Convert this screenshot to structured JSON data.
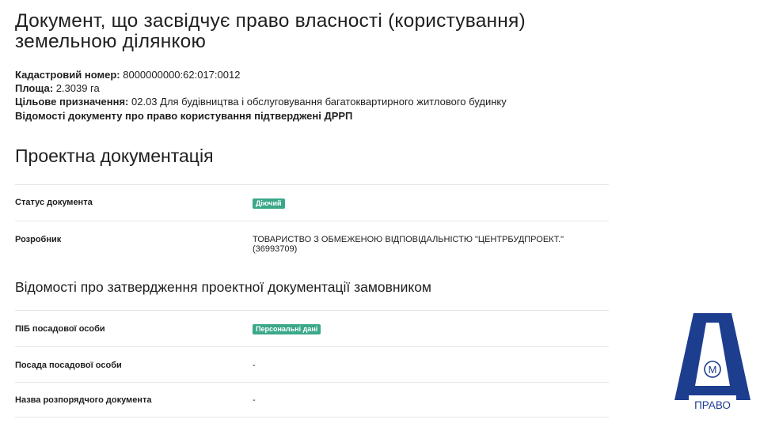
{
  "document": {
    "title": "Документ, що засвідчує право власності (користування) земельною ділянкою",
    "cadastral_label": "Кадастровий номер:",
    "cadastral_value": "8000000000:62:017:0012",
    "area_label": "Площа:",
    "area_value": "2.3039 га",
    "purpose_label": "Цільове призначення:",
    "purpose_value": "02.03 Для будівництва і обслуговування багатоквартирного житлового будинку",
    "drrp_note": "Відомості документу про право користування підтверджені ДРРП"
  },
  "project_docs": {
    "title": "Проектна документація",
    "rows": [
      {
        "label": "Статус документа",
        "badge": "Діючий"
      },
      {
        "label": "Розробник",
        "value": "ТОВАРИСТВО З ОБМЕЖЕНОЮ ВІДПОВІДАЛЬНІСТЮ \"ЦЕНТРБУДПРОЕКТ.\" (36993709)"
      }
    ]
  },
  "approval": {
    "title": "Відомості про затвердження проектної документації замовником",
    "rows": [
      {
        "label": "ПІБ посадової особи",
        "badge": "Персональні дані"
      },
      {
        "label": "Посада посадової особи",
        "value": "-"
      },
      {
        "label": "Назва розпорядчого документа",
        "value": "-"
      }
    ]
  },
  "logo": {
    "letter": "М",
    "text": "ПРАВО",
    "color": "#1d3d8f"
  },
  "colors": {
    "badge": "#3aa889",
    "divider": "#e6e6e6"
  }
}
